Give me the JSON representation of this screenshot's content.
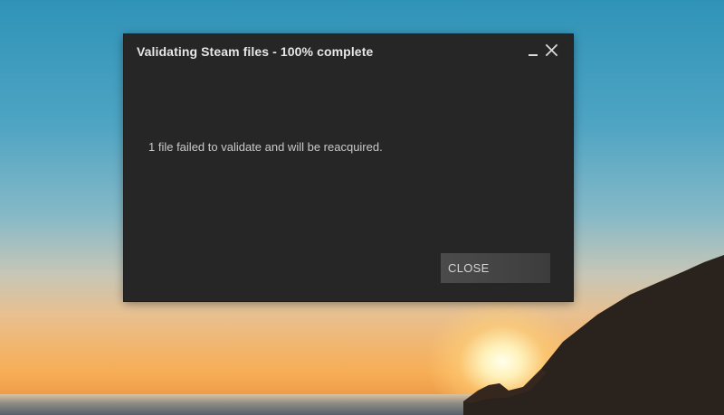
{
  "desktop": {
    "wallpaper": "sunset-over-sea"
  },
  "dialog": {
    "title": "Validating Steam files - 100% complete",
    "message": "1 file failed to validate and will be reacquired.",
    "close_button_label": "CLOSE",
    "progress_percent": 100,
    "icons": {
      "minimize": "minimize-icon",
      "close": "close-icon"
    },
    "colors": {
      "dialog_bg": "#262626",
      "title_text": "#e6e6e6",
      "body_text": "#c9c9c9",
      "button_bg": "#474747"
    }
  }
}
